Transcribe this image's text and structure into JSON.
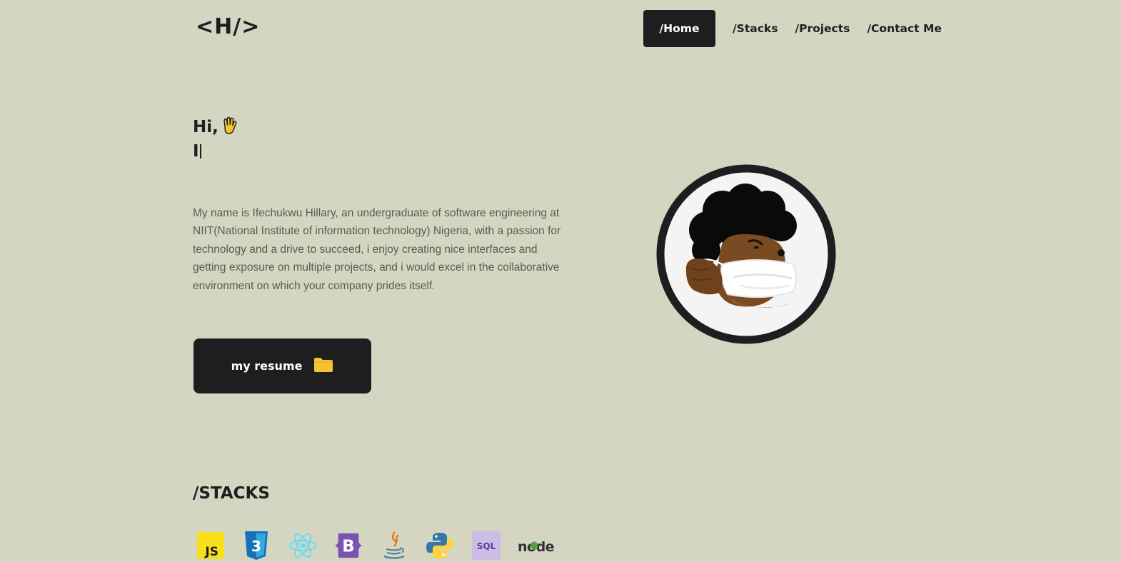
{
  "header": {
    "logo": "<H/>",
    "nav": [
      {
        "label": "/Home",
        "active": true
      },
      {
        "label": "/Stacks",
        "active": false
      },
      {
        "label": "/Projects",
        "active": false
      },
      {
        "label": "/Contact Me",
        "active": false
      }
    ]
  },
  "hero": {
    "greeting": "Hi,",
    "typed_text": "I",
    "bio": "My name is Ifechukwu Hillary, an undergraduate of software engineering at NIIT(National Institute of information technology) Nigeria, with a passion for technology and a drive to succeed, i enjoy creating nice interfaces and getting exposure on multiple projects, and i would excel in the collaborative environment on which your company prides itself.",
    "resume_label": "my resume"
  },
  "stacks": {
    "title": "/STACKS",
    "items": [
      {
        "name": "javascript-icon",
        "label": "JS"
      },
      {
        "name": "css3-icon",
        "label": "3"
      },
      {
        "name": "react-icon",
        "label": ""
      },
      {
        "name": "bootstrap-icon",
        "label": "B"
      },
      {
        "name": "java-icon",
        "label": ""
      },
      {
        "name": "python-icon",
        "label": ""
      },
      {
        "name": "sql-icon",
        "label": "SQL"
      },
      {
        "name": "nodejs-icon",
        "label": "node"
      }
    ]
  },
  "colors": {
    "background": "#d4d6c2",
    "dark": "#1e1d20",
    "body_text": "#5c5a52",
    "folder": "#f4c430"
  }
}
